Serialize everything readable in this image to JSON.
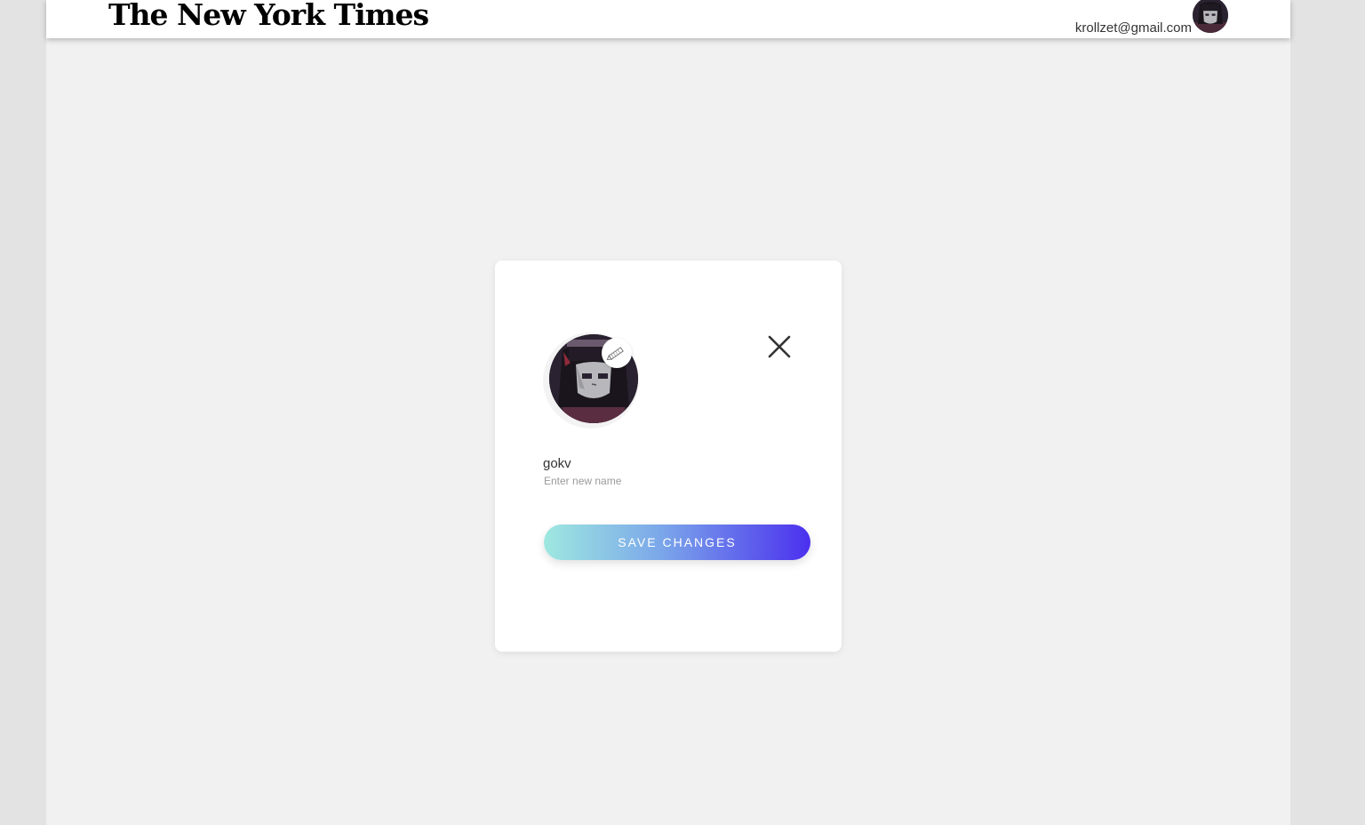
{
  "header": {
    "logo": "The New York Times",
    "user_email": "krollzet@gmail.com"
  },
  "profile_modal": {
    "name_value": "gokv",
    "name_hint": "Enter new name",
    "save_label": "SAVE CHANGES"
  },
  "icons": {
    "close": "close-icon",
    "edit": "pencil-icon"
  },
  "colors": {
    "gradient_start": "#9ee8e0",
    "gradient_end": "#4b30ee",
    "page_background": "#f1f1f1"
  }
}
